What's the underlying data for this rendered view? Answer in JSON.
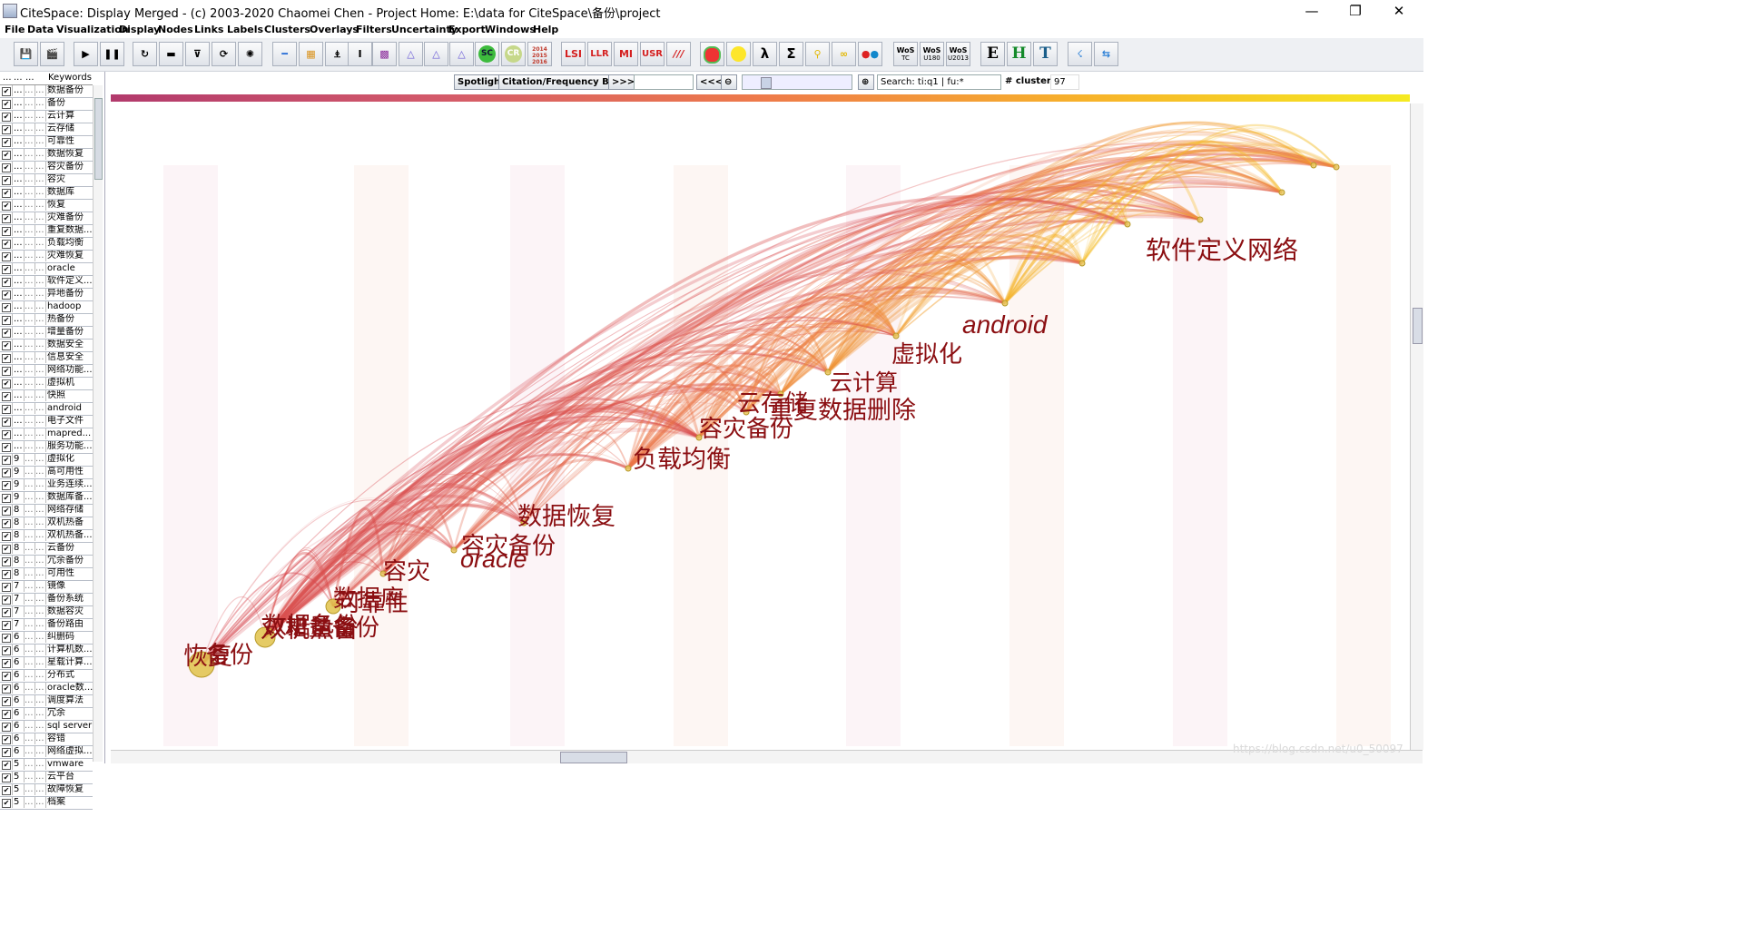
{
  "window": {
    "title": "CiteSpace: Display Merged - (c) 2003-2020 Chaomei Chen - Project Home: E:\\data for CiteSpace\\备份\\project",
    "minimize": "—",
    "maximize": "❐",
    "close": "✕"
  },
  "menu": [
    "File",
    "Data",
    "Visualization",
    "Display",
    "Nodes",
    "Links",
    "Labels",
    "Clusters",
    "Overlays",
    "Filters",
    "Uncertainty",
    "Export",
    "Windows",
    "Help"
  ],
  "toolbar": {
    "year_stack": [
      "2014",
      "2015",
      "2016"
    ],
    "text_buttons": [
      "LSI",
      "LLR",
      "MI",
      "USR",
      "///"
    ],
    "sc": "SC",
    "cr": "CR",
    "wos": [
      {
        "t": "WoS",
        "s": "TC"
      },
      {
        "t": "WoS",
        "s": "U180"
      },
      {
        "t": "WoS",
        "s": "U2013"
      }
    ],
    "letters": [
      "E",
      "H",
      "T"
    ]
  },
  "table": {
    "header": [
      "...",
      "...",
      "...",
      "Keywords"
    ],
    "rows": [
      {
        "c": "...",
        "k": "数据备份"
      },
      {
        "c": "...",
        "k": "备份"
      },
      {
        "c": "...",
        "k": "云计算"
      },
      {
        "c": "...",
        "k": "云存储"
      },
      {
        "c": "...",
        "k": "可靠性"
      },
      {
        "c": "...",
        "k": "数据恢复"
      },
      {
        "c": "...",
        "k": "容灾备份"
      },
      {
        "c": "...",
        "k": "容灾"
      },
      {
        "c": "...",
        "k": "数据库"
      },
      {
        "c": "...",
        "k": "恢复"
      },
      {
        "c": "...",
        "k": "灾难备份"
      },
      {
        "c": "...",
        "k": "重复数据..."
      },
      {
        "c": "...",
        "k": "负载均衡"
      },
      {
        "c": "...",
        "k": "灾难恢复"
      },
      {
        "c": "...",
        "k": "oracle"
      },
      {
        "c": "...",
        "k": "软件定义..."
      },
      {
        "c": "...",
        "k": "异地备份"
      },
      {
        "c": "...",
        "k": "hadoop"
      },
      {
        "c": "...",
        "k": "热备份"
      },
      {
        "c": "...",
        "k": "增量备份"
      },
      {
        "c": "...",
        "k": "数据安全"
      },
      {
        "c": "...",
        "k": "信息安全"
      },
      {
        "c": "...",
        "k": "网络功能..."
      },
      {
        "c": "...",
        "k": "虚拟机"
      },
      {
        "c": "...",
        "k": "快照"
      },
      {
        "c": "...",
        "k": "android"
      },
      {
        "c": "...",
        "k": "电子文件"
      },
      {
        "c": "...",
        "k": "mapred..."
      },
      {
        "c": "...",
        "k": "服务功能..."
      },
      {
        "c": "9",
        "k": "虚拟化"
      },
      {
        "c": "9",
        "k": "高可用性"
      },
      {
        "c": "9",
        "k": "业务连续..."
      },
      {
        "c": "9",
        "k": "数据库备..."
      },
      {
        "c": "8",
        "k": "网络存储"
      },
      {
        "c": "8",
        "k": "双机热备"
      },
      {
        "c": "8",
        "k": "双机热备..."
      },
      {
        "c": "8",
        "k": "云备份"
      },
      {
        "c": "8",
        "k": "冗余备份"
      },
      {
        "c": "8",
        "k": "可用性"
      },
      {
        "c": "7",
        "k": "镜像"
      },
      {
        "c": "7",
        "k": "备份系统"
      },
      {
        "c": "7",
        "k": "数据容灾"
      },
      {
        "c": "7",
        "k": "备份路由"
      },
      {
        "c": "6",
        "k": "纠删码"
      },
      {
        "c": "6",
        "k": "计算机数..."
      },
      {
        "c": "6",
        "k": "星载计算..."
      },
      {
        "c": "6",
        "k": "分布式"
      },
      {
        "c": "6",
        "k": "oracle数..."
      },
      {
        "c": "6",
        "k": "调度算法"
      },
      {
        "c": "6",
        "k": "冗余"
      },
      {
        "c": "6",
        "k": "sql server"
      },
      {
        "c": "6",
        "k": "容错"
      },
      {
        "c": "6",
        "k": "网络虚拟..."
      },
      {
        "c": "5",
        "k": "vmware"
      },
      {
        "c": "5",
        "k": "云平台"
      },
      {
        "c": "5",
        "k": "故障恢复"
      },
      {
        "c": "5",
        "k": "档案"
      }
    ]
  },
  "controls": {
    "spotlight": "Spotlight",
    "burst": "Citation/Frequency Burst",
    "next": ">>>",
    "prev": "<<<",
    "search_value": "Search: ti:q1 | fu:*",
    "clusters_label": "# clusters",
    "clusters_value": "97"
  },
  "labels": [
    {
      "t": "软件定义网络",
      "sz": 28
    },
    {
      "t": "android",
      "sz": 28
    },
    {
      "t": "虚拟化",
      "sz": 26
    },
    {
      "t": "云计算",
      "sz": 25
    },
    {
      "t": "重复数据删除",
      "sz": 27
    },
    {
      "t": "云存储",
      "sz": 26
    },
    {
      "t": "容灾备份",
      "sz": 26
    },
    {
      "t": "负载均衡",
      "sz": 27
    },
    {
      "t": "数据恢复",
      "sz": 27
    },
    {
      "t": "容灾备份",
      "sz": 26
    },
    {
      "t": "oracle",
      "sz": 27
    },
    {
      "t": "容灾",
      "sz": 26
    },
    {
      "t": "数据库",
      "sz": 26
    },
    {
      "t": "可靠性",
      "sz": 26
    },
    {
      "t": "双机热备",
      "sz": 27
    },
    {
      "t": "增量备份",
      "sz": 26
    },
    {
      "t": "数据备份",
      "sz": 26
    },
    {
      "t": "恢复",
      "sz": 27
    },
    {
      "t": "备份",
      "sz": 26
    }
  ],
  "watermark": "https://blog.csdn.net/u0_50097"
}
